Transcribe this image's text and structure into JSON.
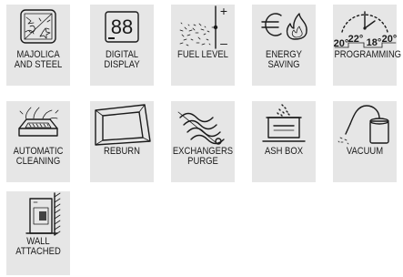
{
  "features": [
    {
      "id": "majolica",
      "icon": "majolica-steel-icon",
      "lines": [
        "MAJOLICA",
        "AND STEEL"
      ]
    },
    {
      "id": "digital",
      "icon": "digital-display-icon",
      "lines": [
        "DIGITAL",
        "DISPLAY"
      ],
      "display_digits": "88"
    },
    {
      "id": "fuel",
      "icon": "fuel-level-icon",
      "lines": [
        "FUEL LEVEL"
      ],
      "plus": "+",
      "minus": "–"
    },
    {
      "id": "energy",
      "icon": "energy-saving-icon",
      "lines": [
        "ENERGY",
        "SAVING"
      ]
    },
    {
      "id": "programming",
      "icon": "programming-icon",
      "lines": [
        "PROGRAMMING"
      ],
      "temps": [
        "20°",
        "22°",
        "18°",
        "20°"
      ]
    },
    {
      "id": "auto-cleaning",
      "icon": "automatic-cleaning-icon",
      "lines": [
        "AUTOMATIC",
        "CLEANING"
      ]
    },
    {
      "id": "reburn",
      "icon": "reburn-icon",
      "lines": [
        "REBURN"
      ]
    },
    {
      "id": "exchangers",
      "icon": "exchangers-purge-icon",
      "lines": [
        "EXCHANGERS",
        "PURGE"
      ]
    },
    {
      "id": "ash-box",
      "icon": "ash-box-icon",
      "lines": [
        "ASH BOX"
      ]
    },
    {
      "id": "vacuum",
      "icon": "vacuum-icon",
      "lines": [
        "VACUUM"
      ]
    },
    {
      "id": "wall",
      "icon": "wall-attached-icon",
      "lines": [
        "WALL",
        "ATTACHED"
      ]
    }
  ]
}
